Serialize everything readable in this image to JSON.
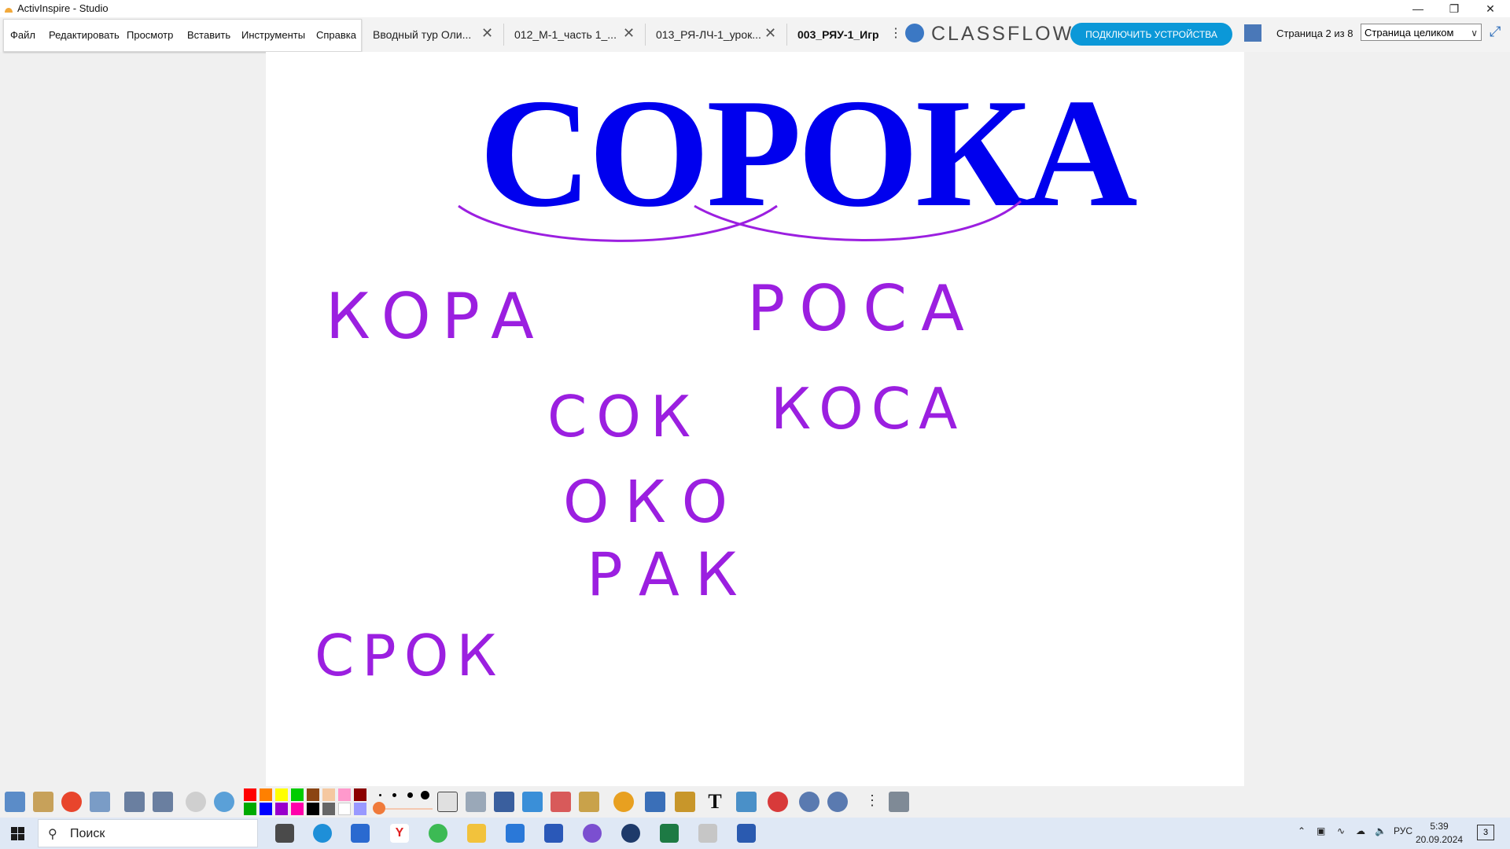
{
  "window": {
    "title": "ActivInspire - Studio"
  },
  "menu": {
    "items": [
      "Файл",
      "Редактировать",
      "Просмотр",
      "Вставить",
      "Инструменты",
      "Справка"
    ]
  },
  "tabs": [
    {
      "label": "Вводный тур Оли...",
      "active": false
    },
    {
      "label": "012_М-1_часть 1_...",
      "active": false
    },
    {
      "label": "013_РЯ-ЛЧ-1_урок...",
      "active": false
    },
    {
      "label": "003_РЯУ-1_Игр",
      "active": true
    }
  ],
  "classflow": {
    "logo": "CLASSFLOW",
    "connect_label": "ПОДКЛЮЧИТЬ УСТРОЙСТВА"
  },
  "page": {
    "status": "Страница 2 из 8",
    "zoom": "Страница целиком"
  },
  "canvas": {
    "main_word": "СОРОКА",
    "main_word_color": "#0000ee",
    "ink_color": "#9b1fe0",
    "words": [
      "КОРА",
      "РОСА",
      "СОК",
      "КОСА",
      "ОКО",
      "РАК",
      "СРОК"
    ]
  },
  "toolbar": {
    "palette": [
      "#ff0000",
      "#ff8000",
      "#ffff00",
      "#00cc00",
      "#8b4513",
      "#f5c8a0",
      "#ff99cc",
      "#8b0000",
      "#00aa00",
      "#0000ff",
      "#9900cc",
      "#ff00aa",
      "#000000",
      "#666666",
      "#ffffff",
      "#9999ff"
    ]
  },
  "taskbar": {
    "search_placeholder": "Поиск",
    "lang": "РУС",
    "time": "5:39",
    "date": "20.09.2024",
    "notifications": "3"
  }
}
